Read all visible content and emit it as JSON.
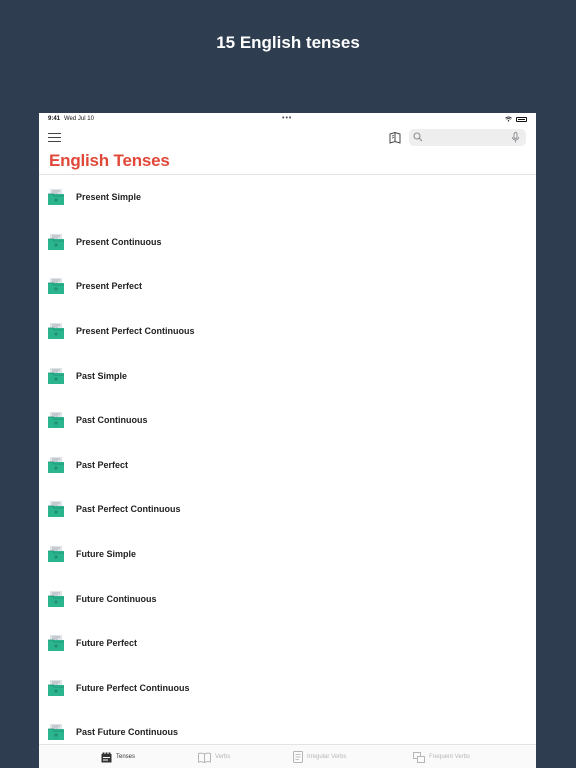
{
  "promo": {
    "title": "15 English tenses"
  },
  "status": {
    "time": "9:41",
    "date": "Wed Jul 10",
    "dots": "•••"
  },
  "nav": {
    "title": "English Tenses",
    "search_placeholder": ""
  },
  "tenses": [
    "Present Simple",
    "Present Continuous",
    "Present Perfect",
    "Present Perfect Continuous",
    "Past Simple",
    "Past Continuous",
    "Past Perfect",
    "Past Perfect Continuous",
    "Future Simple",
    "Future Continuous",
    "Future Perfect",
    "Future Perfect Continuous",
    "Past Future Continuous"
  ],
  "tabs": [
    {
      "label": "Tenses",
      "icon": "tenses-icon",
      "active": true
    },
    {
      "label": "Verbs",
      "icon": "book-open-icon",
      "active": false
    },
    {
      "label": "Irregular Verbs",
      "icon": "document-icon",
      "active": false
    },
    {
      "label": "Frequent Verbs",
      "icon": "cards-icon",
      "active": false
    }
  ],
  "colors": {
    "background": "#2e3e50",
    "accent": "#e0493a",
    "icon_green": "#2bb58f"
  }
}
